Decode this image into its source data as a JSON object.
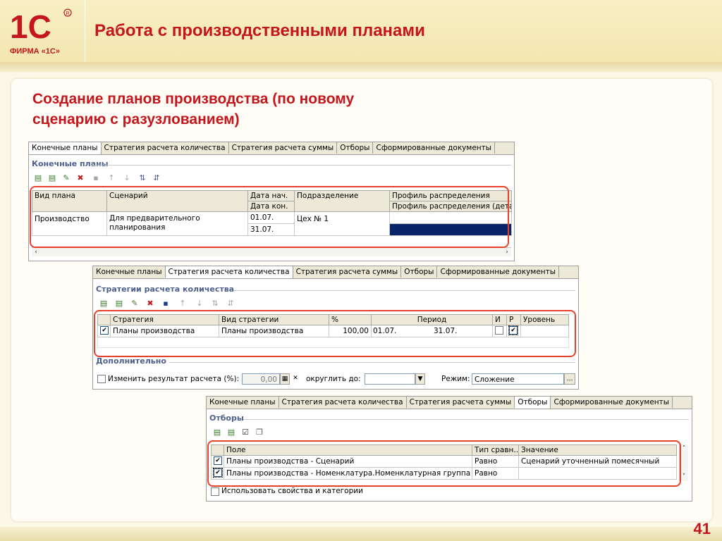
{
  "slide": {
    "title": "Работа с производственными планами",
    "subtitle_line1": "Создание планов производства (по новому",
    "subtitle_line2": "сценарию с разузлованием)",
    "page_number": "41",
    "logo_text": "ФИРМА «1С»",
    "logo_mark": "1С",
    "accent_color": "#c4161c"
  },
  "form1": {
    "tabs": [
      "Конечные планы",
      "Стратегия расчета количества",
      "Стратегия расчета суммы",
      "Отборы",
      "Сформированные документы"
    ],
    "active_tab": 0,
    "section": "Конечные планы",
    "columns": {
      "plan_type": "Вид плана",
      "scenario": "Сценарий",
      "date_start": "Дата нач.",
      "date_end": "Дата кон.",
      "division": "Подразделение",
      "profile": "Профиль распределения",
      "profile_detail": "Профиль распределения (дета"
    },
    "row": {
      "plan_type": "Производство",
      "scenario": "Для предварительного планирования",
      "date_start": "01.07.",
      "date_end": "31.07.",
      "division": "Цех № 1"
    }
  },
  "form2": {
    "tabs": [
      "Конечные планы",
      "Стратегия расчета количества",
      "Стратегия расчета суммы",
      "Отборы",
      "Сформированные документы"
    ],
    "active_tab": 1,
    "section": "Стратегии расчета количества",
    "columns": {
      "strategy": "Стратегия",
      "strategy_type": "Вид стратегии",
      "percent": "%",
      "period": "Период",
      "i": "И",
      "r": "Р",
      "level": "Уровень"
    },
    "row": {
      "checked": true,
      "strategy": "Планы производства",
      "strategy_type": "Планы производства",
      "percent": "100,00",
      "period_start": "01.07.",
      "period_end": "31.07.",
      "i_checked": false,
      "r_checked": true
    },
    "additional_section": "Дополнительно",
    "change_result_label": "Изменить результат расчета (%):",
    "change_result_value": "0,00",
    "round_label": "округлить до:",
    "round_value": "",
    "mode_label": "Режим:",
    "mode_value": "Сложение"
  },
  "form3": {
    "tabs": [
      "Конечные планы",
      "Стратегия расчета количества",
      "Стратегия расчета суммы",
      "Отборы",
      "Сформированные документы"
    ],
    "active_tab": 3,
    "section": "Отборы",
    "columns": {
      "field": "Поле",
      "compare": "Тип сравн...",
      "value": "Значение"
    },
    "rows": [
      {
        "checked": true,
        "field": "Планы производства - Сценарий",
        "compare": "Равно",
        "value": "Сценарий уточненный помесячный"
      },
      {
        "checked": true,
        "field": "Планы производства - Номенклатура.Номенклатурная группа",
        "compare": "Равно",
        "value": ""
      }
    ],
    "use_properties_label": "Использовать свойства и категории"
  }
}
